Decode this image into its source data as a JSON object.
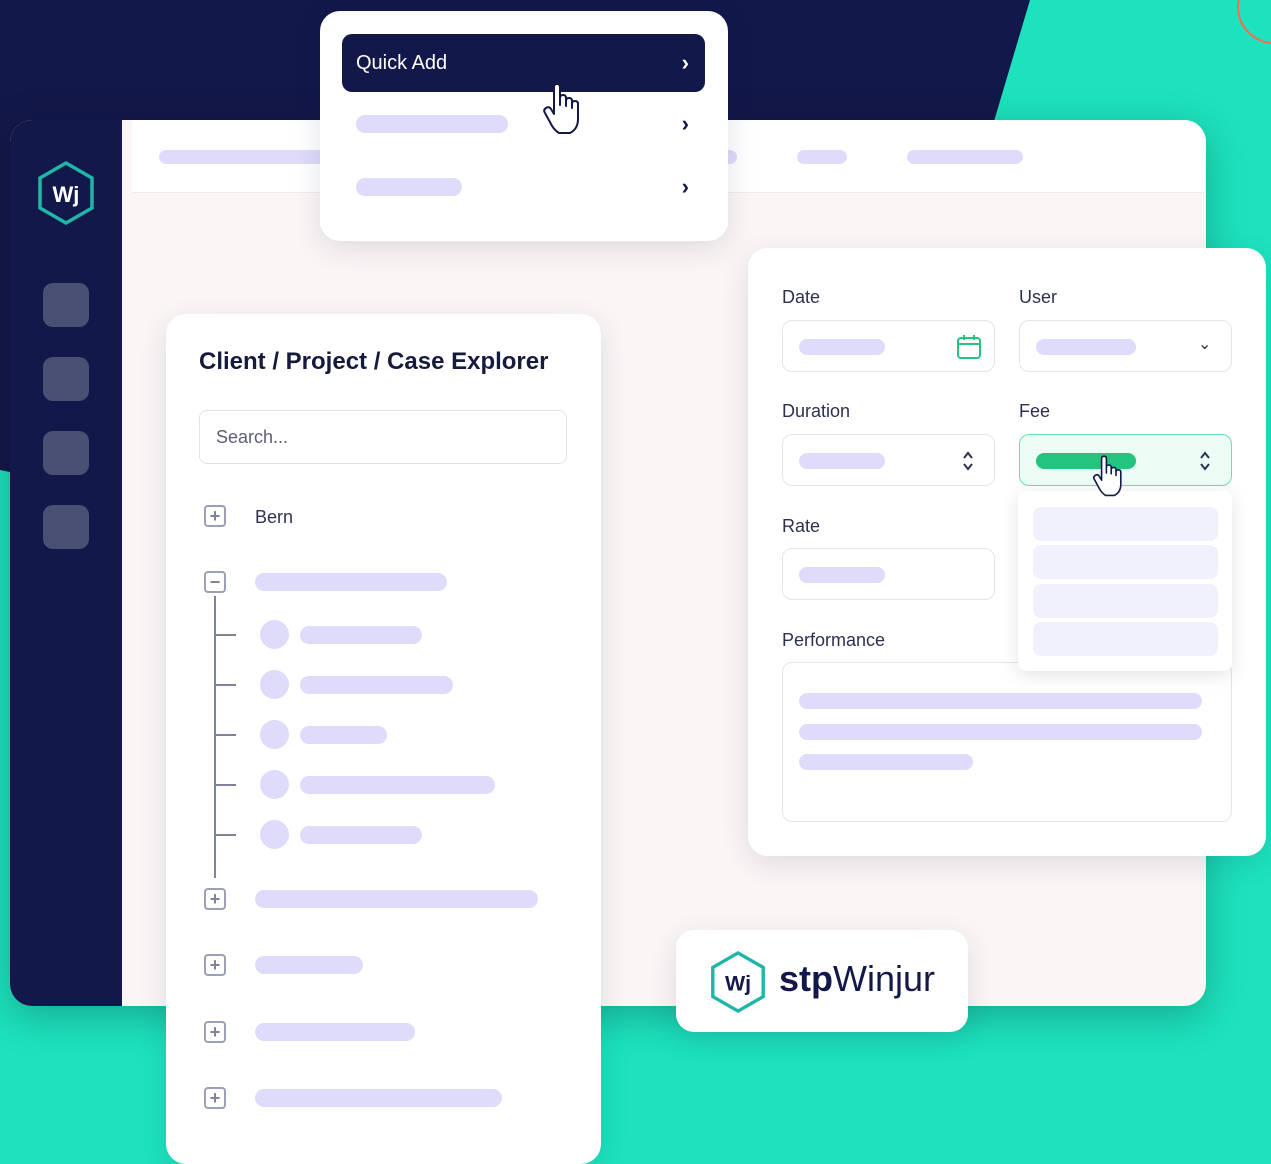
{
  "colors": {
    "navy": "#13184a",
    "teal": "#1de2bd",
    "accent_green": "#22c47e",
    "skeleton": "#dedbfb",
    "logo_teal": "#1fb5a7"
  },
  "sidebar": {
    "logo_text": "Wj"
  },
  "quick_menu": {
    "items": [
      {
        "label": "Quick Add",
        "active": true,
        "icon": "chevron-right-icon"
      }
    ]
  },
  "explorer": {
    "title": "Client / Project / Case Explorer",
    "search": {
      "placeholder": "Search..."
    },
    "tree": [
      {
        "label": "Bern",
        "expanded": false
      }
    ]
  },
  "form": {
    "date_label": "Date",
    "user_label": "User",
    "duration_label": "Duration",
    "fee_label": "Fee",
    "rate_label": "Rate",
    "performance_label": "Performance",
    "icons": {
      "date": "calendar-icon",
      "user": "chevron-down-icon",
      "duration": "stepper-icon",
      "fee": "stepper-icon"
    }
  },
  "brand": {
    "logo_text": "Wj",
    "name_strong": "stp",
    "name_rest": "Winjur"
  }
}
